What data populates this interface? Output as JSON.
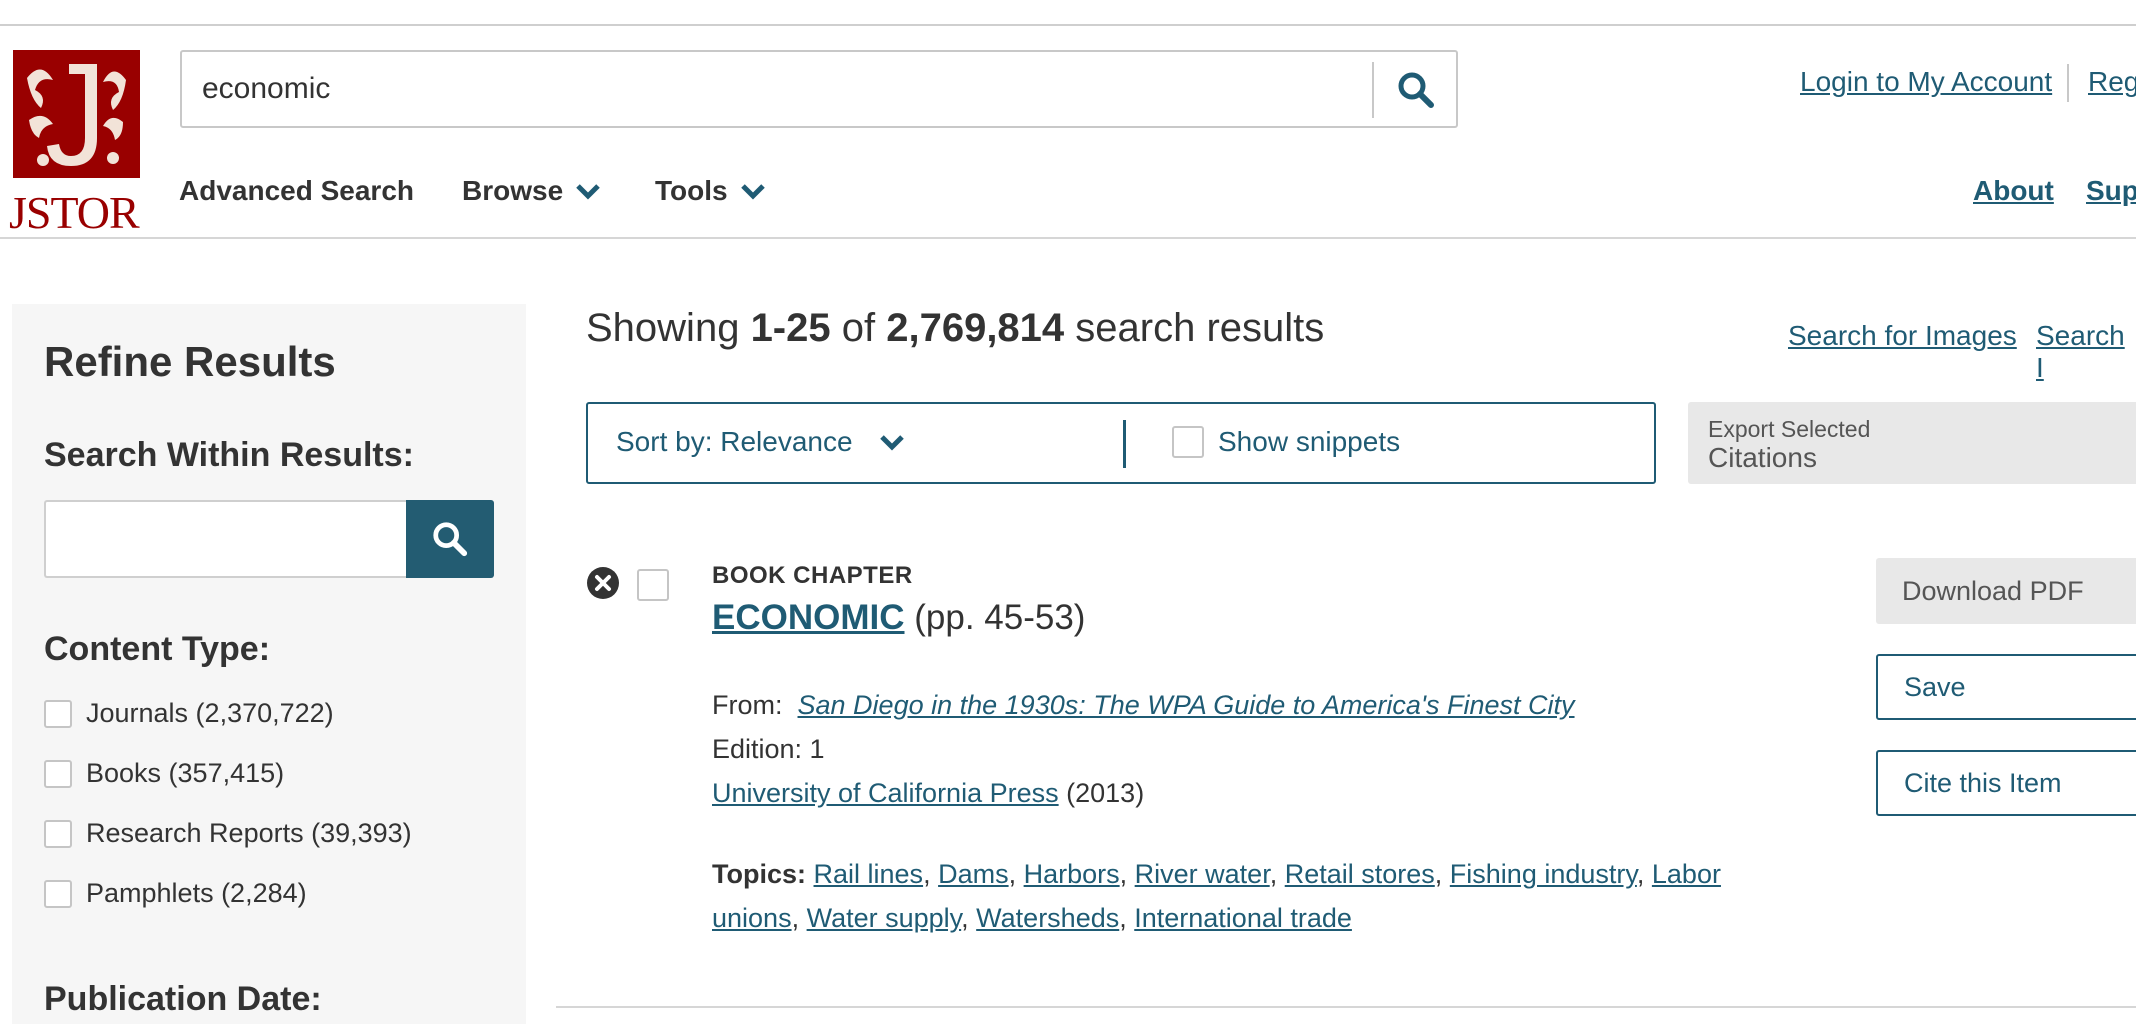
{
  "brand": {
    "wordmark": "JSTOR",
    "color": "#990000"
  },
  "search": {
    "value": "economic",
    "placeholder": ""
  },
  "account": {
    "login": "Login to My Account",
    "register_partial": "Reg"
  },
  "nav": {
    "advanced_search": "Advanced Search",
    "browse": "Browse",
    "tools": "Tools",
    "about": "About",
    "support_partial": "Sup"
  },
  "sidebar": {
    "title": "Refine Results",
    "search_within_label": "Search Within Results:",
    "search_within_value": "",
    "content_type_label": "Content Type:",
    "content_types": [
      {
        "label": "Journals (2,370,722)",
        "checked": false
      },
      {
        "label": "Books (357,415)",
        "checked": false
      },
      {
        "label": "Research Reports (39,393)",
        "checked": false
      },
      {
        "label": "Pamphlets (2,284)",
        "checked": false
      }
    ],
    "publication_date_label": "Publication Date:"
  },
  "results": {
    "showing_prefix": "Showing ",
    "range": "1-25",
    "of": " of ",
    "total": "2,769,814",
    "suffix": " search results",
    "search_images": "Search for Images",
    "search_partial": "Search I"
  },
  "toolbar": {
    "sort_label": "Sort by: Relevance",
    "show_snippets": "Show snippets",
    "export_line1": "Export Selected",
    "export_line2": "Citations"
  },
  "item": {
    "type": "BOOK CHAPTER",
    "title": "ECONOMIC",
    "pages": "(pp. 45-53)",
    "from_label": "From:",
    "book_title": "San Diego in the 1930s: The WPA Guide to America's Finest City",
    "edition": "Edition: 1",
    "publisher": "University of California Press",
    "year": "(2013)",
    "topics_label": "Topics:",
    "topics": [
      "Rail lines",
      "Dams",
      "Harbors",
      "River water",
      "Retail stores",
      "Fishing industry",
      "Labor unions",
      "Water supply",
      "Watersheds",
      "International trade"
    ],
    "download": "Download PDF",
    "save": "Save",
    "cite": "Cite this Item"
  },
  "colors": {
    "link": "#1f5b74",
    "accent": "#235c72",
    "brand": "#990000"
  }
}
